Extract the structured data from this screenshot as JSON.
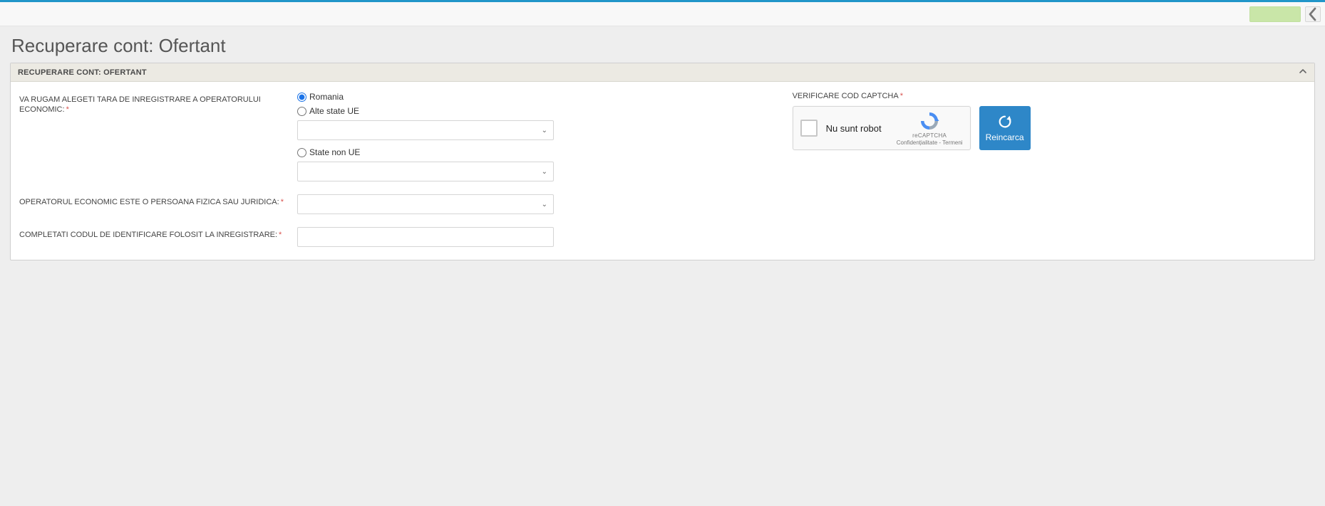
{
  "page": {
    "title": "Recuperare cont: Ofertant"
  },
  "panel": {
    "title": "RECUPERARE CONT: OFERTANT"
  },
  "form": {
    "country_label": "VA RUGAM ALEGETI TARA DE INREGISTRARE A OPERATORULUI ECONOMIC:",
    "radio_romania": "Romania",
    "radio_eu": "Alte state UE",
    "radio_noneu": "State non UE",
    "selected_country": "romania",
    "eu_select_value": "",
    "noneu_select_value": "",
    "person_type_label": "OPERATORUL ECONOMIC ESTE O PERSOANA FIZICA SAU JURIDICA:",
    "person_type_value": "",
    "code_label": "COMPLETATI CODUL DE IDENTIFICARE FOLOSIT LA INREGISTRARE:",
    "code_value": ""
  },
  "captcha": {
    "label": "VERIFICARE COD CAPTCHA",
    "not_robot": "Nu sunt robot",
    "brand": "reCAPTCHA",
    "legal": "Confidențialitate - Termeni",
    "reload": "Reincarca"
  }
}
